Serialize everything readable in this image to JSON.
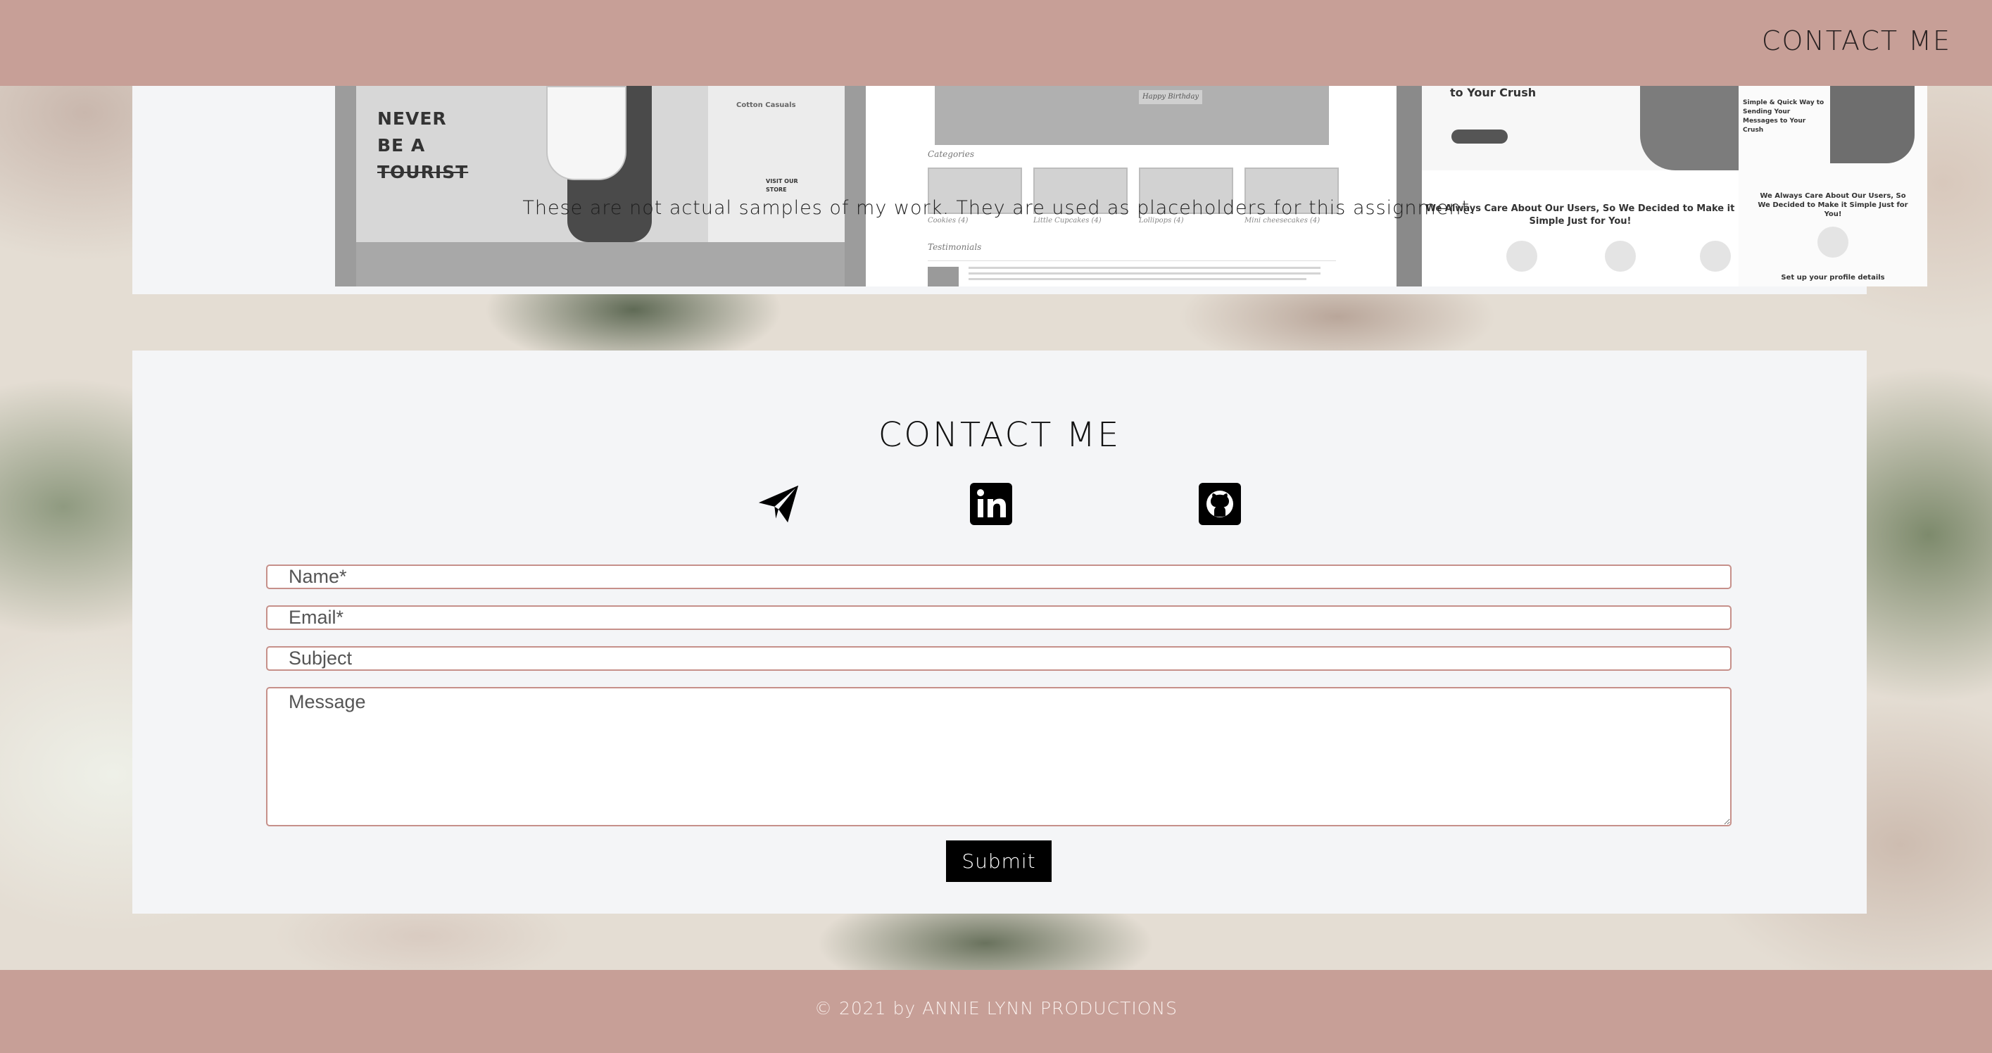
{
  "nav": {
    "contact_label": "CONTACT ME"
  },
  "portfolio": {
    "shot_1": {
      "headline_lines": [
        "NEVER",
        "BE A",
        "TOURIST"
      ],
      "side_title": "Cotton Casuals",
      "side_link": "VISIT OUR STORE"
    },
    "shot_2": {
      "categories_label": "Categories",
      "captions": [
        "Cookies (4)",
        "Little Cupcakes (4)",
        "Lollipops (4)",
        "Mini cheesecakes (4)"
      ],
      "testimonials_label": "Testimonials",
      "hero_badge": "Happy Birthday"
    },
    "shot_3": {
      "heading": "to Your Crush",
      "left_center": "We Always Care About Our Users, So We Decided to Make it Simple Just for You!",
      "right_title": "Simple & Quick Way to Sending Your Messages to Your Crush",
      "right_center": "We Always Care About Our Users, So We Decided to Make it Simple Just for You!",
      "step_label": "Set up your profile details"
    },
    "disclaimer": "These are not actual samples of my work. They are used as placeholders for this assignment."
  },
  "contact": {
    "title": "CONTACT ME",
    "icons": {
      "email": "paper-plane-icon",
      "linkedin": "linkedin-icon",
      "github": "github-icon"
    },
    "fields": {
      "name_placeholder": "Name*",
      "email_placeholder": "Email*",
      "subject_placeholder": "Subject",
      "message_placeholder": "Message"
    },
    "submit_label": "Submit"
  },
  "footer": {
    "copyright": "© 2021 by ANNIE LYNN PRODUCTIONS"
  },
  "colors": {
    "band": "#c79f97",
    "panel": "#f4f5f7",
    "field_border": "#c6908a",
    "button": "#000000"
  }
}
